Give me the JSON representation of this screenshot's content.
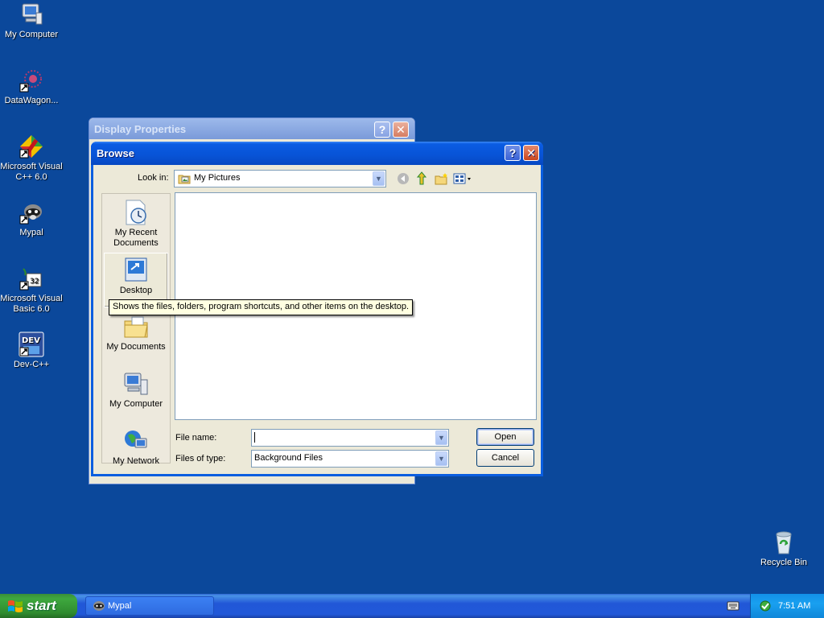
{
  "desktop": {
    "icons": [
      {
        "label": "My Computer"
      },
      {
        "label": "DataWagon..."
      },
      {
        "label": "Microsoft Visual C++ 6.0"
      },
      {
        "label": "Mypal"
      },
      {
        "label": "Microsoft Visual Basic 6.0"
      },
      {
        "label": "Dev-C++"
      },
      {
        "label": "Recycle Bin"
      }
    ]
  },
  "display_properties": {
    "title": "Display Properties",
    "help_glyph": "?",
    "close_glyph": "✕"
  },
  "browse": {
    "title": "Browse",
    "help_glyph": "?",
    "close_glyph": "✕",
    "look_in_label": "Look in:",
    "look_in_value": "My Pictures",
    "places": [
      {
        "label": "My Recent Documents"
      },
      {
        "label": "Desktop"
      },
      {
        "label": "My Documents"
      },
      {
        "label": "My Computer"
      },
      {
        "label": "My Network"
      }
    ],
    "tooltip": "Shows the files, folders, program shortcuts, and other items on the desktop.",
    "file_name_label": "File name:",
    "file_name_value": "",
    "files_of_type_label": "Files of type:",
    "files_of_type_value": "Background Files",
    "open_label": "Open",
    "cancel_label": "Cancel"
  },
  "taskbar": {
    "start_label": "start",
    "tasks": [
      {
        "label": "Mypal"
      }
    ],
    "clock": "7:51 AM"
  },
  "colors": {
    "desktop": "#0b489b",
    "title_active": "#0853d6",
    "dialog_face": "#ece9d8",
    "start_green": "#3ea83e"
  }
}
